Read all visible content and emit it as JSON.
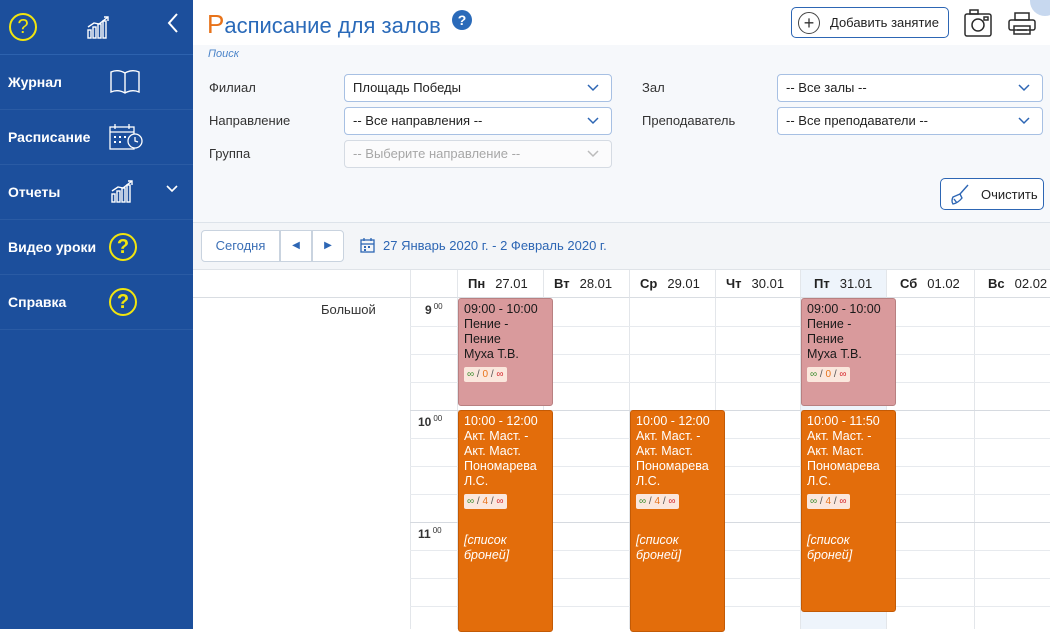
{
  "sidebar": {
    "items": [
      {
        "label": "Журнал",
        "icon": "book-icon"
      },
      {
        "label": "Расписание",
        "icon": "calendar-clock-icon"
      },
      {
        "label": "Отчеты",
        "icon": "chart-icon"
      },
      {
        "label": "Видео уроки",
        "icon": "help-icon"
      },
      {
        "label": "Справка",
        "icon": "help-icon"
      }
    ],
    "colors": {
      "bg": "#1c4f9c",
      "icon_yellow": "#f1e50f"
    }
  },
  "header": {
    "title_first": "Р",
    "title_rest": "асписание для залов",
    "add_label": "Добавить занятие",
    "title_color": "#2a6ab9",
    "accent": "#e8731a"
  },
  "search": {
    "label": "Поиск",
    "branch": {
      "label": "Филиал",
      "value": "Площадь Победы"
    },
    "hall": {
      "label": "Зал",
      "value": "-- Все залы --"
    },
    "direction": {
      "label": "Направление",
      "value": "-- Все направления --"
    },
    "teacher": {
      "label": "Преподаватель",
      "value": "-- Все преподаватели --"
    },
    "group": {
      "label": "Группа",
      "value": "-- Выберите направление --"
    },
    "clear_label": "Очистить"
  },
  "toolbar": {
    "today_label": "Сегодня",
    "prev_glyph": "◀",
    "next_glyph": "▶",
    "range": "27 Январь 2020 г. - 2 Февраль 2020 г."
  },
  "calendar": {
    "hall_name": "Большой",
    "days": [
      {
        "dow": "Пн",
        "date": "27.01"
      },
      {
        "dow": "Вт",
        "date": "28.01"
      },
      {
        "dow": "Ср",
        "date": "29.01"
      },
      {
        "dow": "Чт",
        "date": "30.01"
      },
      {
        "dow": "Пт",
        "date": "31.01"
      },
      {
        "dow": "Сб",
        "date": "01.02"
      },
      {
        "dow": "Вс",
        "date": "02.02"
      }
    ],
    "hours": [
      {
        "h": "9",
        "m": "00"
      },
      {
        "h": "10",
        "m": "00"
      },
      {
        "h": "11",
        "m": "00"
      }
    ],
    "events": [
      {
        "time": "09:00 - 10:00",
        "l1": "Пение -",
        "l2": "Пение",
        "l3": "Муха Т.В.",
        "g": "∞",
        "o": "0",
        "r": "∞"
      },
      {
        "time": "09:00 - 10:00",
        "l1": "Пение -",
        "l2": "Пение",
        "l3": "Муха Т.В.",
        "g": "∞",
        "o": "0",
        "r": "∞"
      },
      {
        "time": "10:00 - 12:00",
        "l1": "Акт. Маст. -",
        "l2": "Акт. Маст.",
        "l3": "Пономарева",
        "l4": "Л.С.",
        "g": "∞",
        "o": "4",
        "r": "∞",
        "list1": "[список",
        "list2": "броней]"
      },
      {
        "time": "10:00 - 12:00",
        "l1": "Акт. Маст. -",
        "l2": "Акт. Маст.",
        "l3": "Пономарева",
        "l4": "Л.С.",
        "g": "∞",
        "o": "4",
        "r": "∞",
        "list1": "[список",
        "list2": "броней]"
      },
      {
        "time": "10:00 - 11:50",
        "l1": "Акт. Маст. -",
        "l2": "Акт. Маст.",
        "l3": "Пономарева",
        "l4": "Л.С.",
        "g": "∞",
        "o": "4",
        "r": "∞",
        "list1": "[список",
        "list2": "броней]"
      }
    ],
    "colors": {
      "pink": "#d99a9c",
      "orange": "#e36d0b"
    }
  }
}
